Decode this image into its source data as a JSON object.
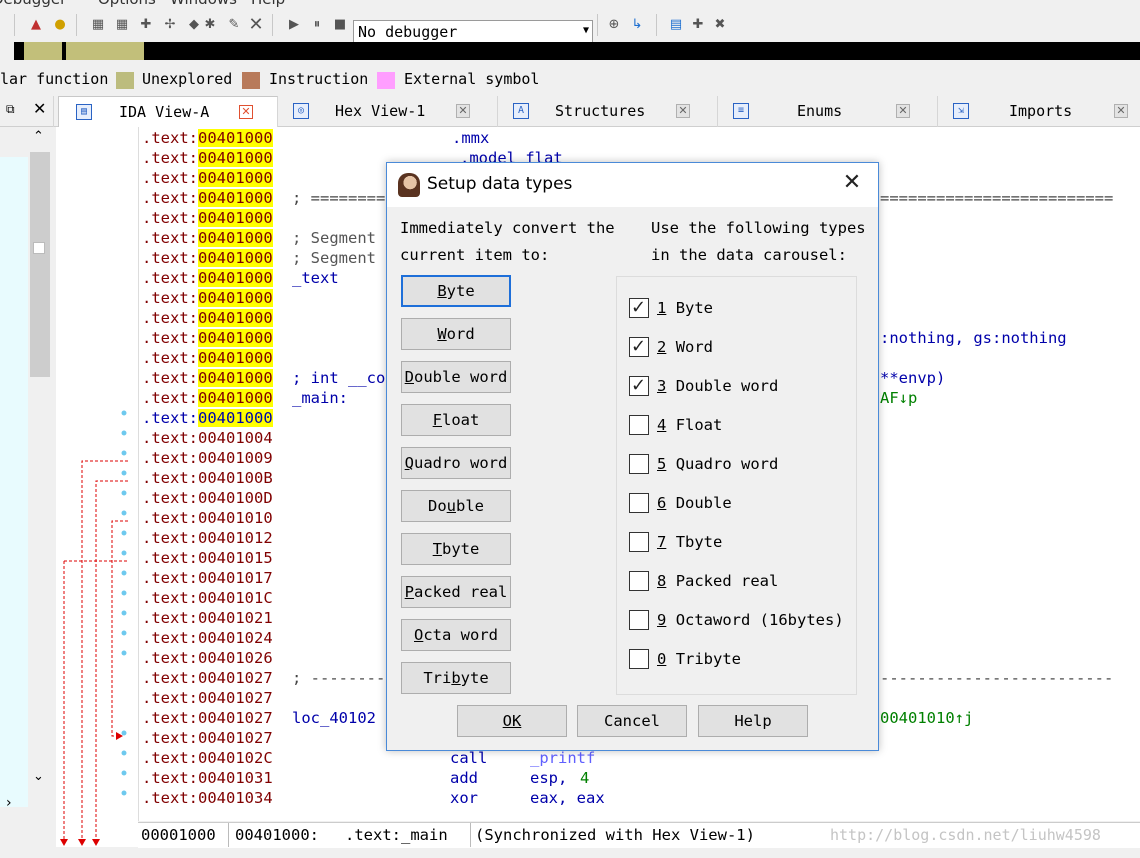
{
  "menu": {
    "items": [
      {
        "label": "Debugger"
      },
      {
        "label": "Options"
      },
      {
        "label": "Windows"
      },
      {
        "label": "Help"
      }
    ]
  },
  "toolbar": {
    "debugger_select": "No debugger"
  },
  "legend": {
    "items": [
      {
        "label": "lar function",
        "color": "#f0f0f0"
      },
      {
        "label": "Unexplored",
        "color": "#bcbc7e"
      },
      {
        "label": "Instruction",
        "color": "#b87a5a"
      },
      {
        "label": "External symbol",
        "color": "#ff9eff"
      }
    ]
  },
  "tabs": [
    {
      "label": "IDA View-A",
      "icon": "ida-view-icon",
      "active": true
    },
    {
      "label": "Hex View-1",
      "icon": "hex-view-icon",
      "active": false
    },
    {
      "label": "Structures",
      "icon": "structures-icon",
      "active": false
    },
    {
      "label": "Enums",
      "icon": "enums-icon",
      "active": false
    },
    {
      "label": "Imports",
      "icon": "imports-icon",
      "active": false
    }
  ],
  "listing": {
    "lines": [
      {
        "seg": ".text:",
        "addr": "00401000",
        "hl": true
      },
      {
        "seg": ".text:",
        "addr": "00401000",
        "hl": true
      },
      {
        "seg": ".text:",
        "addr": "00401000",
        "hl": true
      },
      {
        "seg": ".text:",
        "addr": "00401000",
        "hl": true
      },
      {
        "seg": ".text:",
        "addr": "00401000",
        "hl": true
      },
      {
        "seg": ".text:",
        "addr": "00401000",
        "hl": true
      },
      {
        "seg": ".text:",
        "addr": "00401000",
        "hl": true
      },
      {
        "seg": ".text:",
        "addr": "00401000",
        "hl": true
      },
      {
        "seg": ".text:",
        "addr": "00401000",
        "hl": true
      },
      {
        "seg": ".text:",
        "addr": "00401000",
        "hl": true
      },
      {
        "seg": ".text:",
        "addr": "00401000",
        "hl": true
      },
      {
        "seg": ".text:",
        "addr": "00401000",
        "hl": true
      },
      {
        "seg": ".text:",
        "addr": "00401000",
        "hl": true
      },
      {
        "seg": ".text:",
        "addr": "00401000",
        "hl": true
      },
      {
        "seg": ".text:",
        "addr": "00401000",
        "hl": true
      },
      {
        "seg": ".text:",
        "addr": "00401004",
        "hl": false
      },
      {
        "seg": ".text:",
        "addr": "00401009",
        "hl": false
      },
      {
        "seg": ".text:",
        "addr": "0040100B",
        "hl": false
      },
      {
        "seg": ".text:",
        "addr": "0040100D",
        "hl": false
      },
      {
        "seg": ".text:",
        "addr": "00401010",
        "hl": false
      },
      {
        "seg": ".text:",
        "addr": "00401012",
        "hl": false
      },
      {
        "seg": ".text:",
        "addr": "00401015",
        "hl": false
      },
      {
        "seg": ".text:",
        "addr": "00401017",
        "hl": false
      },
      {
        "seg": ".text:",
        "addr": "0040101C",
        "hl": false
      },
      {
        "seg": ".text:",
        "addr": "00401021",
        "hl": false
      },
      {
        "seg": ".text:",
        "addr": "00401024",
        "hl": false
      },
      {
        "seg": ".text:",
        "addr": "00401026",
        "hl": false
      },
      {
        "seg": ".text:",
        "addr": "00401027",
        "hl": false
      },
      {
        "seg": ".text:",
        "addr": "00401027",
        "hl": false
      },
      {
        "seg": ".text:",
        "addr": "00401027",
        "hl": false
      },
      {
        "seg": ".text:",
        "addr": "00401027",
        "hl": false
      },
      {
        "seg": ".text:",
        "addr": "0040102C",
        "hl": false
      },
      {
        "seg": ".text:",
        "addr": "00401031",
        "hl": false
      },
      {
        "seg": ".text:",
        "addr": "00401034",
        "hl": false
      }
    ],
    "code": {
      "mmx": ".mmx",
      "model": ".model flat",
      "sep_top": "; ==========",
      "sep_top_right": "=========================",
      "segment1": "; Segment",
      "segment2": "; Segment",
      "text_label": "_text",
      "assume_tail": ":nothing, gs:nothing",
      "int_decl": "; int __co",
      "envp_tail": "**envp)",
      "main_label": "_main:",
      "af_tail": "AF↓p",
      "sep_bottom": "; ----------",
      "sep_bottom_right": "-------------------------",
      "loc_label": "loc_40102",
      "xref_tail": "00401010↑j",
      "call_mn": "call",
      "call_op": "_printf",
      "add_mn": "add",
      "add_op": "esp, ",
      "add_num": "4",
      "xor_mn": "xor",
      "xor_op": "eax, eax"
    }
  },
  "status": {
    "offset": "00001000",
    "address": "00401000:",
    "location": ".text:_main",
    "sync": "(Synchronized with Hex View-1)",
    "watermark": "http://blog.csdn.net/liuhw4598"
  },
  "dialog": {
    "title": "Setup data types",
    "left_heading_1": "Immediately convert the",
    "left_heading_2": "current item to:",
    "right_heading_1": "Use the following types",
    "right_heading_2": "in the data carousel:",
    "convert_buttons": [
      {
        "pre": "",
        "key": "B",
        "post": "yte",
        "default": true
      },
      {
        "pre": "",
        "key": "W",
        "post": "ord",
        "default": false
      },
      {
        "pre": "",
        "key": "D",
        "post": "ouble word",
        "default": false
      },
      {
        "pre": "",
        "key": "F",
        "post": "loat",
        "default": false
      },
      {
        "pre": "",
        "key": "Q",
        "post": "uadro word",
        "default": false
      },
      {
        "pre": "Do",
        "key": "u",
        "post": "ble",
        "default": false
      },
      {
        "pre": "",
        "key": "T",
        "post": "byte",
        "default": false
      },
      {
        "pre": "",
        "key": "P",
        "post": "acked real",
        "default": false
      },
      {
        "pre": "",
        "key": "O",
        "post": "cta word",
        "default": false
      },
      {
        "pre": "Tri",
        "key": "b",
        "post": "yte",
        "default": false
      }
    ],
    "carousel": [
      {
        "num": "1",
        "label": "Byte",
        "checked": true
      },
      {
        "num": "2",
        "label": "Word",
        "checked": true
      },
      {
        "num": "3",
        "label": "Double word",
        "checked": true
      },
      {
        "num": "4",
        "label": "Float",
        "checked": false
      },
      {
        "num": "5",
        "label": "Quadro word",
        "checked": false
      },
      {
        "num": "6",
        "label": "Double",
        "checked": false
      },
      {
        "num": "7",
        "label": "Tbyte",
        "checked": false
      },
      {
        "num": "8",
        "label": "Packed real",
        "checked": false
      },
      {
        "num": "9",
        "label": "Octaword (16bytes)",
        "checked": false
      },
      {
        "num": "0",
        "label": "Tribyte",
        "checked": false
      }
    ],
    "ok_label": "OK",
    "cancel_label": "Cancel",
    "help_label": "Help"
  }
}
